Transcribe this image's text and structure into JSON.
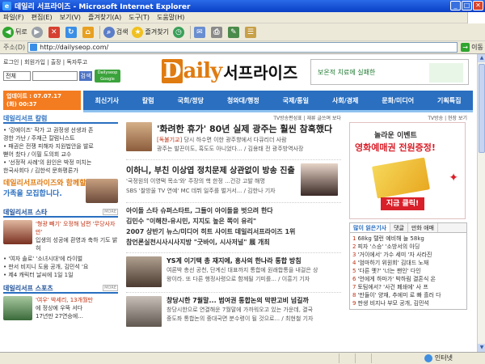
{
  "window": {
    "title": "데일리 서프라이즈 - Microsoft Internet Explorer",
    "menu": [
      "파일(F)",
      "편집(E)",
      "보기(V)",
      "즐겨찾기(A)",
      "도구(T)",
      "도움말(H)"
    ],
    "toolbar": {
      "back": "뒤로",
      "search": "검색",
      "favorites": "즐겨찾기"
    },
    "address_label": "주소(D)",
    "address_value": "http://dailyseop.com/",
    "go_label": "이동",
    "status_zone": "인터넷"
  },
  "page": {
    "login_links": "로그인 | 회원가입 | 출장 | 독자투고",
    "search_select": "전체",
    "search_button": "검색",
    "google_badge": "Dailyseop Google",
    "logo_prefix": "D",
    "logo_rest": "aily",
    "logo_korean": "서프라이즈",
    "ad_top": "보온적 치료에 실패한",
    "dateline_1": "업데이트 : 07.07.17",
    "dateline_2": "(화) 00:37",
    "nav": [
      "최신기사",
      "칼럼",
      "국회/정당",
      "청와대/행정",
      "국제/통일",
      "사회/경제",
      "문화/미디어",
      "기획특집"
    ],
    "left": {
      "section1": "데일리서프 칼럼",
      "news1": [
        "• '강에이즈' 작가 고 권정생 선생과 존",
        "  경한 가난 / 주재근 칼럼니스트",
        "• 패권은 전쟁 피해자 지원법안을 발로",
        "  뻗어 찼다 / 이필 도의회 교수",
        "• '선정적 사례'의 원인은 박정 미치는",
        "  한국사회다 / 김한석 문화평론가"
      ],
      "recruit_1": "데일리서프라이즈와 함께할",
      "recruit_2": "가족을 모집합니다.",
      "section2": "데일리서프 스타",
      "star_title": "'형광 빼기' 오정해 남편 '무당사자만'",
      "star_sub": "입생의 성공에 환영과 축하 기도 밝혀",
      "star_bullets": [
        "• '여자 솔로' '소녀시대'에 라이벌",
        "• 판서 비지니 도움 공개, 김민석 '요",
        "• 제4 캐릭터 날씨에 1일 1일"
      ],
      "section3": "데일리서프 스포츠",
      "sport_title": "'여우' 박세리, 13개월만",
      "sport_sub": "에 정상에 우뚝 서다",
      "sport_sub2": "17년만 27연승에..."
    },
    "middle": {
      "links": "TV방송편성표 | 재류 글쓰며 보다",
      "h1_title": "'화려한 휴가' 80년 실제 광주는 훨씬 참혹했다",
      "h1_tag": "[독불기교]",
      "h1_sub1": "당시 하수면 이한 광주향에서 다큐리더 사람",
      "h1_sub2": "광주는 발끈이도, 흑도도 아니었다... / 김용태 전 광주방역사장",
      "s2_title": "이하니, 부친 이상엽 정치문제 상관없이 방송 진출",
      "s2_sub1": "'국정원의 이영택 목소'와' 주장의 핵 한정 ...건강 고발 해명",
      "s2_sub2": "SBS '찰방울 TV 연예' MC 데뷔 일주를 벌거서... / 김한나 기자",
      "headlines": [
        "아이돌 스타 슈퍼스타트, 그들이 아이돌을 벗으려 한다",
        "김민수 \"이해찬-유시민, 지지도 높은 쪽이 유리\"",
        "2007 상반기 뉴스/미디어 히트 사이트 데일리서프라이즈 1위",
        "참언론실천시사시사지방 \"굿바이, 시사저널\" 展 개최"
      ],
      "s3_title": "YS계 이기택 총 재지에, 흥사의 한나라 통합 방침",
      "s3_sub1": "여론박 총선 공천, 단계신 대표까지 통합에 원래합통을 내걸은 상",
      "s3_sub2": "왕이라. 또 다른 행정사령으로 함께될 기미를... / 이흥기 기자",
      "s4_title": "창당시한 7월말... 범여권 통합논의 막판고비 넘길까",
      "s4_sub1": "창당시한으로 연결해운 7월말에 가까워오고 있는 가운데, 결국",
      "s4_sub2": "중도좌 통합논의 중대국면 분수령이 될 것으로... / 최현철 기자"
    },
    "right": {
      "links": "TV방송 | 현장 보기",
      "event_1": "놀라운 이벤트",
      "event_2": "영화예매권 전원증정!",
      "event_button": "지금 클릭!",
      "tabs": [
        "많이 읽은기사",
        "댓글",
        "만화 애매"
      ],
      "ranked": [
        "68kg 탤런 예비해 늘 58kg",
        "피자 '스승' '소방서의 아딩",
        "'거이에서' 가수 세미 '자 사라진",
        "'엄마하기 위원회' 김대드 노재",
        "'다른 옛?' '너는 팬인' 다인",
        "'언에게 하마가' 박하림 결혼식 온",
        "토팀에서? '사건 폐쇄에' 사 프",
        "'만들이' 양재, 추에미 로 빠 흘러 다",
        "판생 비지나 부모 공개, 김민석"
      ]
    },
    "colors": {
      "nav": "#2a6fc0",
      "accent": "#e07b10",
      "alert": "#d8202a"
    }
  }
}
